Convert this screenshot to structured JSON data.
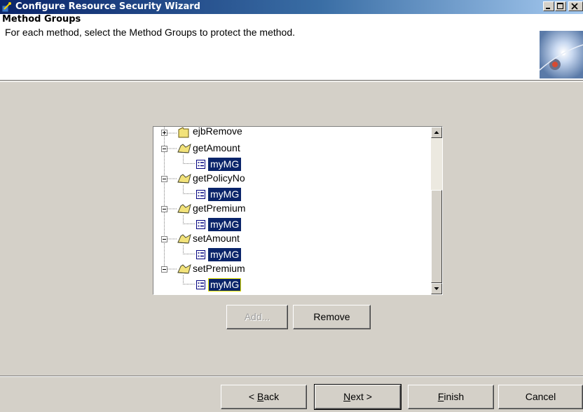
{
  "window": {
    "title": "Configure Resource Security Wizard",
    "controls": [
      "minimize-icon",
      "maximize-icon",
      "close-icon"
    ]
  },
  "header": {
    "title": "Method Groups",
    "subtitle": "For each method, select the Method Groups to protect the method."
  },
  "tree": {
    "nodes": [
      {
        "label": "ejbRemove",
        "expanded": false,
        "children": []
      },
      {
        "label": "getAmount",
        "expanded": true,
        "children": [
          "myMG"
        ]
      },
      {
        "label": "getPolicyNo",
        "expanded": true,
        "children": [
          "myMG"
        ]
      },
      {
        "label": "getPremium",
        "expanded": true,
        "children": [
          "myMG"
        ]
      },
      {
        "label": "setAmount",
        "expanded": true,
        "children": [
          "myMG"
        ]
      },
      {
        "label": "setPremium",
        "expanded": true,
        "children": [
          "myMG"
        ]
      }
    ]
  },
  "actions": {
    "add_label": "Add...",
    "remove_label": "Remove"
  },
  "footer": {
    "back_pre": "< ",
    "back_key": "B",
    "back_post": "ack",
    "next_key": "N",
    "next_post": "ext >",
    "finish_key": "F",
    "finish_post": "inish",
    "cancel_label": "Cancel"
  },
  "colors": {
    "selection": "#0a246a",
    "dialog_bg": "#d4d0c8",
    "titlebar_start": "#0a246a",
    "titlebar_end": "#a6caf0"
  }
}
